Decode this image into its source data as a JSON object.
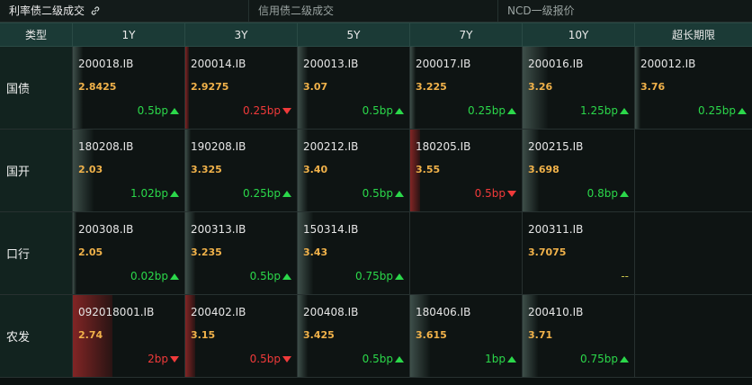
{
  "tabs": [
    {
      "label": "利率债二级成交"
    },
    {
      "label": "信用债二级成交"
    },
    {
      "label": "NCD一级报价"
    }
  ],
  "headers": [
    "类型",
    "1Y",
    "3Y",
    "5Y",
    "7Y",
    "10Y",
    "超长期限"
  ],
  "rows": [
    {
      "type": "国债",
      "cells": [
        {
          "code": "200018.IB",
          "yield": "2.8425",
          "change": "0.5bp",
          "dir": "up",
          "level": 0.1
        },
        {
          "code": "200014.IB",
          "yield": "2.9275",
          "change": "0.25bp",
          "dir": "down",
          "level": 0.04
        },
        {
          "code": "200013.IB",
          "yield": "3.07",
          "change": "0.5bp",
          "dir": "up",
          "level": 0.1
        },
        {
          "code": "200017.IB",
          "yield": "3.225",
          "change": "0.25bp",
          "dir": "up",
          "level": 0.05
        },
        {
          "code": "200016.IB",
          "yield": "3.26",
          "change": "1.25bp",
          "dir": "up",
          "level": 0.25
        },
        {
          "code": "200012.IB",
          "yield": "3.76",
          "change": "0.25bp",
          "dir": "up",
          "level": 0.05
        }
      ]
    },
    {
      "type": "国开",
      "cells": [
        {
          "code": "180208.IB",
          "yield": "2.03",
          "change": "1.02bp",
          "dir": "up",
          "level": 0.21
        },
        {
          "code": "190208.IB",
          "yield": "3.325",
          "change": "0.25bp",
          "dir": "up",
          "level": 0.05
        },
        {
          "code": "200212.IB",
          "yield": "3.40",
          "change": "0.5bp",
          "dir": "up",
          "level": 0.1
        },
        {
          "code": "180205.IB",
          "yield": "3.55",
          "change": "0.5bp",
          "dir": "down",
          "level": 0.1
        },
        {
          "code": "200215.IB",
          "yield": "3.698",
          "change": "0.8bp",
          "dir": "up",
          "level": 0.16
        },
        null
      ]
    },
    {
      "type": "口行",
      "cells": [
        {
          "code": "200308.IB",
          "yield": "2.05",
          "change": "0.02bp",
          "dir": "up",
          "level": 0.0
        },
        {
          "code": "200313.IB",
          "yield": "3.235",
          "change": "0.5bp",
          "dir": "up",
          "level": 0.1
        },
        {
          "code": "150314.IB",
          "yield": "3.43",
          "change": "0.75bp",
          "dir": "up",
          "level": 0.15
        },
        null,
        {
          "code": "200311.IB",
          "yield": "3.7075",
          "change": "--",
          "dir": "flat",
          "level": 0
        },
        null
      ]
    },
    {
      "type": "农发",
      "cells": [
        {
          "code": "092018001.IB",
          "yield": "2.74",
          "change": "2bp",
          "dir": "down",
          "level": 0.4
        },
        {
          "code": "200402.IB",
          "yield": "3.15",
          "change": "0.5bp",
          "dir": "down",
          "level": 0.1
        },
        {
          "code": "200408.IB",
          "yield": "3.425",
          "change": "0.5bp",
          "dir": "up",
          "level": 0.1
        },
        {
          "code": "180406.IB",
          "yield": "3.615",
          "change": "1bp",
          "dir": "up",
          "level": 0.2
        },
        {
          "code": "200410.IB",
          "yield": "3.71",
          "change": "0.75bp",
          "dir": "up",
          "level": 0.15
        },
        null
      ]
    }
  ],
  "colors": {
    "up": "#2bd84a",
    "down": "#f03a3a",
    "yield": "#f1b24a",
    "header_bg": "#1b3a36"
  }
}
